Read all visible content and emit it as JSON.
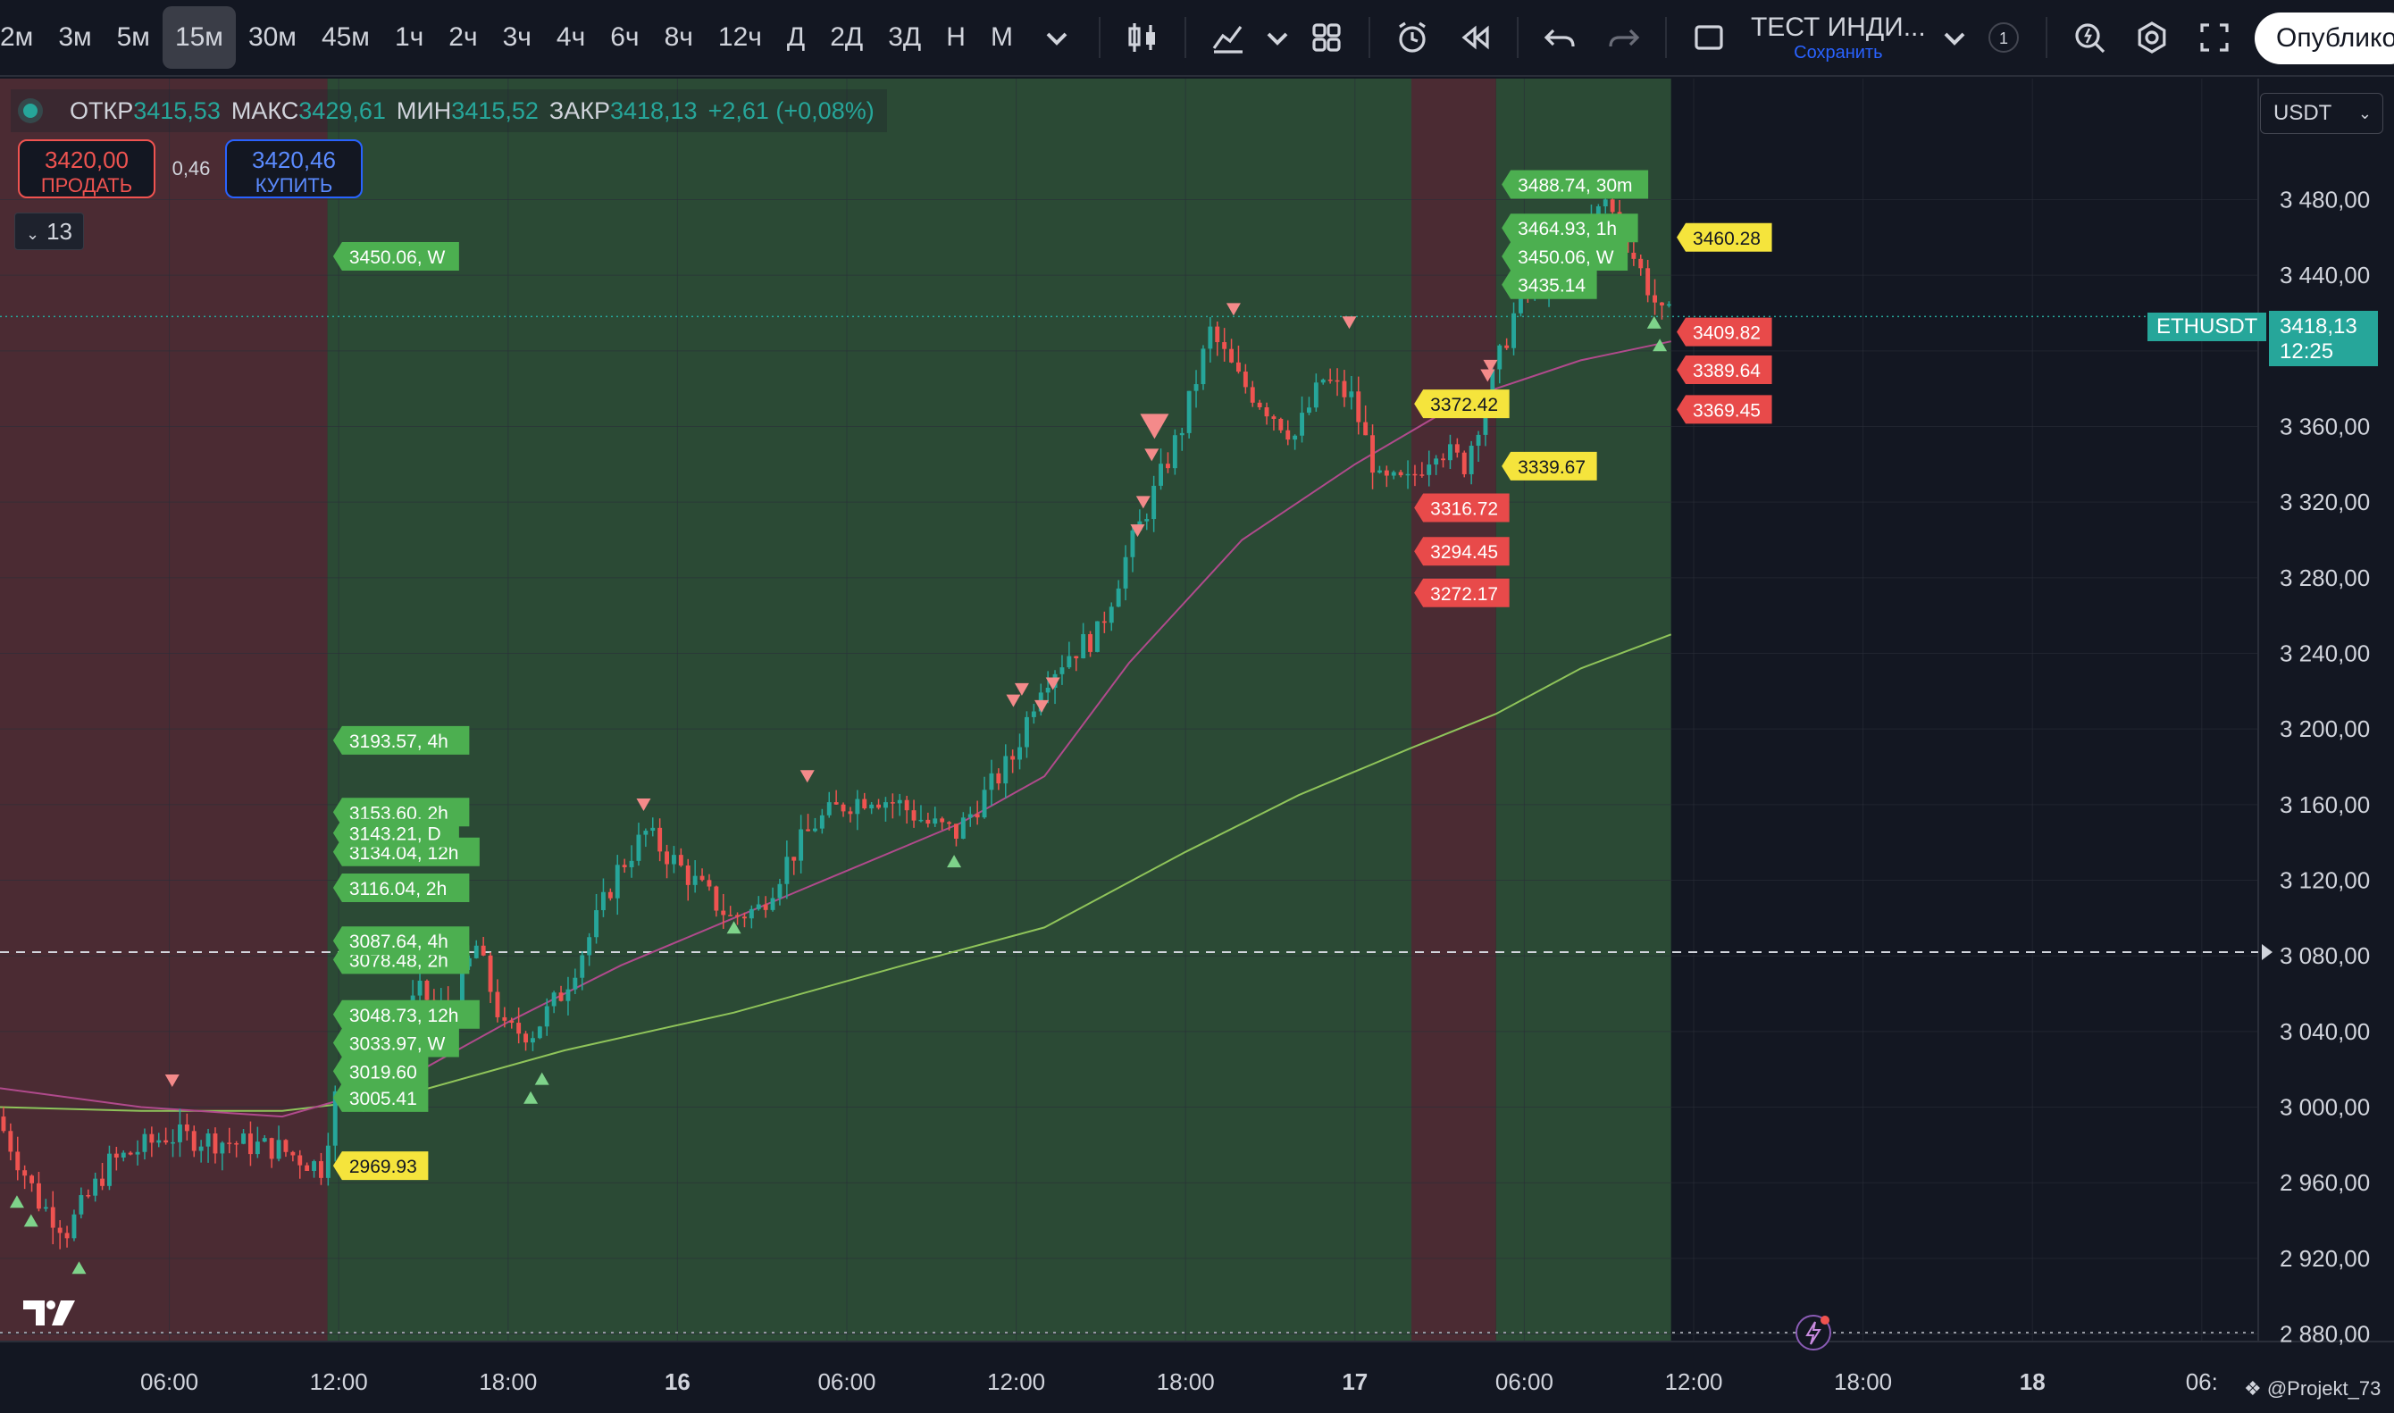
{
  "toolbar": {
    "timeframes": [
      "2м",
      "3м",
      "5м",
      "15м",
      "30м",
      "45м",
      "1ч",
      "2ч",
      "3ч",
      "4ч",
      "6ч",
      "8ч",
      "12ч",
      "Д",
      "2Д",
      "3Д",
      "Н",
      "М"
    ],
    "active_timeframe": "15м",
    "layout_title": "ТЕСТ ИНДИ...",
    "layout_subtitle": "Сохранить",
    "alert_count": "1",
    "publish_label": "Опублико"
  },
  "legend": {
    "open_label": "ОТКР",
    "open": "3415,53",
    "high_label": "МАКС",
    "high": "3429,61",
    "low_label": "МИН",
    "low": "3415,52",
    "close_label": "ЗАКР",
    "close": "3418,13",
    "change": "+2,61 (+0,08%)"
  },
  "trade": {
    "sell_price": "3420,00",
    "sell_label": "ПРОДАТЬ",
    "spread": "0,46",
    "buy_price": "3420,46",
    "buy_label": "КУПИТЬ"
  },
  "indicators_collapse": {
    "label": "13"
  },
  "currency": "USDT",
  "symbol": "ETHUSDT",
  "last_price": "3418,13",
  "countdown": "12:25",
  "watermark": "@Projekt_73",
  "colors": {
    "bg": "#131722",
    "up": "#26a69a",
    "down": "#ef5350",
    "green_zone": "#2b4a35",
    "red_zone": "#4b2b33",
    "ma_fast": "#b04a8c",
    "ma_slow": "#8fc45a",
    "tag_green": "#4caf50",
    "tag_red": "#e84a4a",
    "tag_yellow": "#f5e43c"
  },
  "chart_data": {
    "type": "candlestick",
    "symbol": "ETHUSDT",
    "interval": "15м",
    "y_ticks": [
      "3 480,00",
      "3 440,00",
      "3 400,00",
      "3 360,00",
      "3 320,00",
      "3 280,00",
      "3 240,00",
      "3 200,00",
      "3 160,00",
      "3 120,00",
      "3 080,00",
      "3 040,00",
      "3 000,00",
      "2 960,00",
      "2 920,00",
      "2 880,00"
    ],
    "y_tick_values": [
      3480,
      3440,
      3400,
      3360,
      3320,
      3280,
      3240,
      3200,
      3160,
      3120,
      3080,
      3040,
      3000,
      2960,
      2920,
      2880
    ],
    "ylim": [
      2876,
      3544
    ],
    "x_ticks": [
      "06:00",
      "12:00",
      "18:00",
      "16",
      "06:00",
      "12:00",
      "18:00",
      "17",
      "06:00",
      "12:00",
      "18:00",
      "18",
      "06:"
    ],
    "x_tick_hours": [
      6,
      12,
      18,
      24,
      30,
      36,
      42,
      48,
      54,
      60,
      66,
      72,
      78
    ],
    "xlim_hours": [
      0,
      80
    ],
    "bold_x_ticks": [
      "16",
      "17",
      "18"
    ],
    "dashed_level": 3082,
    "zones": [
      {
        "color": "red",
        "from": 0,
        "to": 11.6
      },
      {
        "color": "green",
        "from": 11.6,
        "to": 50
      },
      {
        "color": "red",
        "from": 50,
        "to": 53
      },
      {
        "color": "green",
        "from": 53,
        "to": 59.2
      }
    ],
    "price_path": [
      [
        0,
        2995
      ],
      [
        1.5,
        2950
      ],
      [
        2.5,
        2935
      ],
      [
        4,
        2970
      ],
      [
        6,
        2985
      ],
      [
        8,
        2982
      ],
      [
        10,
        2978
      ],
      [
        11.5,
        2968
      ],
      [
        12,
        3005
      ],
      [
        13,
        3010
      ],
      [
        14,
        3040
      ],
      [
        15,
        3060
      ],
      [
        16,
        3050
      ],
      [
        17,
        3085
      ],
      [
        18,
        3040
      ],
      [
        19,
        3040
      ],
      [
        20,
        3060
      ],
      [
        21,
        3090
      ],
      [
        22,
        3125
      ],
      [
        23,
        3145
      ],
      [
        24,
        3130
      ],
      [
        25,
        3115
      ],
      [
        26,
        3100
      ],
      [
        27,
        3105
      ],
      [
        28,
        3130
      ],
      [
        29,
        3150
      ],
      [
        30,
        3160
      ],
      [
        31,
        3165
      ],
      [
        32,
        3160
      ],
      [
        33,
        3150
      ],
      [
        34,
        3145
      ],
      [
        35,
        3165
      ],
      [
        36,
        3185
      ],
      [
        37,
        3225
      ],
      [
        38,
        3240
      ],
      [
        39,
        3250
      ],
      [
        40,
        3290
      ],
      [
        41,
        3325
      ],
      [
        42,
        3360
      ],
      [
        43,
        3410
      ],
      [
        44,
        3385
      ],
      [
        45,
        3370
      ],
      [
        46,
        3355
      ],
      [
        47,
        3385
      ],
      [
        48,
        3375
      ],
      [
        49,
        3330
      ],
      [
        50,
        3330
      ],
      [
        51,
        3350
      ],
      [
        52,
        3340
      ],
      [
        53,
        3385
      ],
      [
        54,
        3430
      ],
      [
        55,
        3440
      ],
      [
        56,
        3455
      ],
      [
        57,
        3480
      ],
      [
        58,
        3450
      ],
      [
        59,
        3418
      ]
    ],
    "ma_fast": [
      [
        0,
        3010
      ],
      [
        5,
        3000
      ],
      [
        10,
        2995
      ],
      [
        14,
        3012
      ],
      [
        18,
        3045
      ],
      [
        22,
        3075
      ],
      [
        26,
        3100
      ],
      [
        30,
        3125
      ],
      [
        34,
        3150
      ],
      [
        37,
        3175
      ],
      [
        40,
        3235
      ],
      [
        44,
        3300
      ],
      [
        48,
        3340
      ],
      [
        52,
        3375
      ],
      [
        56,
        3395
      ],
      [
        59.2,
        3405
      ]
    ],
    "ma_slow": [
      [
        0,
        3000
      ],
      [
        5,
        2998
      ],
      [
        10,
        2998
      ],
      [
        14,
        3005
      ],
      [
        20,
        3030
      ],
      [
        26,
        3050
      ],
      [
        32,
        3075
      ],
      [
        37,
        3095
      ],
      [
        42,
        3135
      ],
      [
        46,
        3165
      ],
      [
        50,
        3190
      ],
      [
        53,
        3208
      ],
      [
        56,
        3232
      ],
      [
        59.2,
        3250
      ]
    ],
    "buy_markers": [
      [
        0.6,
        2960
      ],
      [
        1.1,
        2950
      ],
      [
        2.8,
        2925
      ],
      [
        18.8,
        3015
      ],
      [
        19.2,
        3025
      ],
      [
        26,
        3105
      ],
      [
        33.8,
        3140
      ],
      [
        58.6,
        3425
      ],
      [
        58.8,
        3413
      ]
    ],
    "sell_markers": [
      [
        6.1,
        3004
      ],
      [
        22.8,
        3150
      ],
      [
        28.6,
        3165
      ],
      [
        35.9,
        3205
      ],
      [
        36.9,
        3202
      ],
      [
        37.3,
        3214
      ],
      [
        36.2,
        3211
      ],
      [
        40.3,
        3295
      ],
      [
        40.5,
        3310
      ],
      [
        40.8,
        3335
      ],
      [
        43.7,
        3412
      ],
      [
        47.8,
        3405
      ],
      [
        52.7,
        3377
      ],
      [
        52.8,
        3382
      ]
    ],
    "big_sell_marker": [
      40.9,
      3361
    ],
    "level_tags": [
      {
        "text": "3450.06, W",
        "price": 3450,
        "x": 11.8,
        "color": "green"
      },
      {
        "text": "3193.57, 4h",
        "price": 3194,
        "x": 11.8,
        "color": "green"
      },
      {
        "text": "3153.60, 2h",
        "price": 3156,
        "x": 11.8,
        "color": "green"
      },
      {
        "text": "3134.04, 12h",
        "price": 3135,
        "x": 11.8,
        "color": "green"
      },
      {
        "text": "3143.21, D",
        "price": 3145,
        "x": 11.8,
        "color": "green"
      },
      {
        "text": "3116.04, 2h",
        "price": 3116,
        "x": 11.8,
        "color": "green"
      },
      {
        "text": "3078.48, 2h",
        "price": 3078,
        "x": 11.8,
        "color": "green"
      },
      {
        "text": "3087.64, 4h",
        "price": 3088,
        "x": 11.8,
        "color": "green"
      },
      {
        "text": "3048.73, 12h",
        "price": 3049,
        "x": 11.8,
        "color": "green"
      },
      {
        "text": "3033.97, W",
        "price": 3034,
        "x": 11.8,
        "color": "green"
      },
      {
        "text": "3019.60",
        "price": 3019,
        "x": 11.8,
        "color": "green"
      },
      {
        "text": "3005.41",
        "price": 3005,
        "x": 11.8,
        "color": "green"
      },
      {
        "text": "2969.93",
        "price": 2969,
        "x": 11.8,
        "color": "yellow"
      },
      {
        "text": "3488.74, 30m",
        "price": 3488,
        "x": 53.2,
        "color": "green"
      },
      {
        "text": "3464.93, 1h",
        "price": 3465,
        "x": 53.2,
        "color": "green"
      },
      {
        "text": "3450.06, W",
        "price": 3450,
        "x": 53.2,
        "color": "green"
      },
      {
        "text": "3435.14",
        "price": 3435,
        "x": 53.2,
        "color": "green"
      },
      {
        "text": "3372.42",
        "price": 3372,
        "x": 50.1,
        "color": "yellow"
      },
      {
        "text": "3339.67",
        "price": 3339,
        "x": 53.2,
        "color": "yellow"
      },
      {
        "text": "3316.72",
        "price": 3317,
        "x": 50.1,
        "color": "red"
      },
      {
        "text": "3294.45",
        "price": 3294,
        "x": 50.1,
        "color": "red"
      },
      {
        "text": "3272.17",
        "price": 3272,
        "x": 50.1,
        "color": "red"
      },
      {
        "text": "3460.28",
        "price": 3460,
        "x": 59.4,
        "color": "yellow"
      },
      {
        "text": "3409.82",
        "price": 3410,
        "x": 59.4,
        "color": "red"
      },
      {
        "text": "3389.64",
        "price": 3390,
        "x": 59.4,
        "color": "red"
      },
      {
        "text": "3369.45",
        "price": 3369,
        "x": 59.4,
        "color": "red"
      }
    ]
  }
}
